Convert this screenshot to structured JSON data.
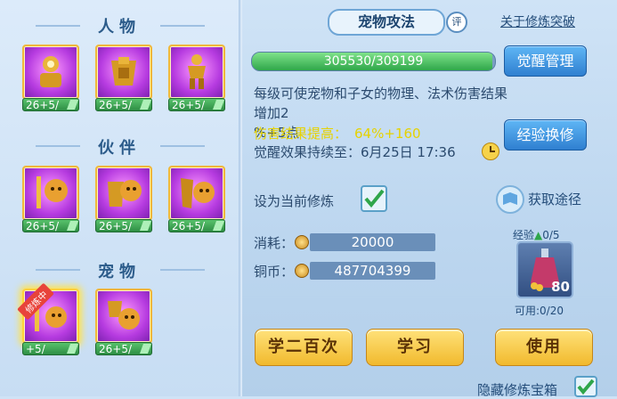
{
  "left": {
    "sections": [
      {
        "title": "人物",
        "items": [
          {
            "label": "26+5/"
          },
          {
            "label": "26+5/"
          },
          {
            "label": "26+5/"
          }
        ]
      },
      {
        "title": "伙伴",
        "items": [
          {
            "label": "26+5/"
          },
          {
            "label": "26+5/"
          },
          {
            "label": "26+5/"
          }
        ]
      },
      {
        "title": "宠物",
        "items": [
          {
            "label": "+5/",
            "badge": "修炼中"
          },
          {
            "label": "26+5/"
          }
        ]
      }
    ]
  },
  "header": {
    "title": "宠物攻法",
    "rate_badge": "评",
    "about_link": "关于修炼突破"
  },
  "progress": {
    "text": "305530/309199",
    "current": 305530,
    "max": 309199
  },
  "buttons": {
    "awaken": "觉醒管理",
    "exp_exchange": "经验换修",
    "get_path": "获取途径",
    "learn_200": "学二百次",
    "learn": "学习",
    "use": "使用"
  },
  "description": {
    "line1": "每级可使宠物和子女的物理、法术伤害结果增加2",
    "line2": "%+5点"
  },
  "boost": {
    "label": "伤害结果提高：",
    "value": "64%+160"
  },
  "awaken_duration": {
    "label": "觉醒效果持续至：",
    "value": "6月25日 17:36"
  },
  "set_current": {
    "label": "设为当前修炼",
    "checked": true
  },
  "cost": {
    "label": "消耗：",
    "value": "20000"
  },
  "coins": {
    "label": "铜币：",
    "value": "487704399"
  },
  "exp_item": {
    "label": "经验",
    "count": "0/5",
    "qty": "80",
    "available": "可用:0/20"
  },
  "hide_box": {
    "label": "隐藏修炼宝箱",
    "checked": true
  },
  "colors": {
    "accent_blue": "#2f7fd0",
    "gold": "#f1b92d",
    "boost_yellow": "#e6d200",
    "purple": "#b63be0"
  }
}
